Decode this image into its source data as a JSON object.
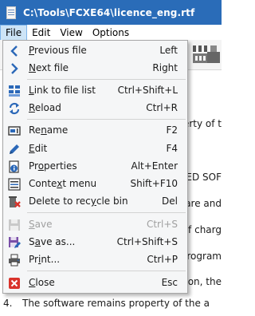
{
  "window": {
    "title": "C:\\Tools\\FCXE64\\licence_eng.rtf",
    "icon": "document-icon"
  },
  "menubar": {
    "items": [
      {
        "label": "File",
        "active": true
      },
      {
        "label": "Edit"
      },
      {
        "label": "View"
      },
      {
        "label": "Options"
      }
    ]
  },
  "file_menu": {
    "items": [
      {
        "label": "Previous file",
        "accel": "P",
        "shortcut": "Left",
        "icon": "chevron-left-icon"
      },
      {
        "label": "Next file",
        "accel": "N",
        "shortcut": "Right",
        "icon": "chevron-right-icon"
      },
      {
        "label": "Link to file list",
        "accel": "L",
        "shortcut": "Ctrl+Shift+L",
        "icon": "link-icon"
      },
      {
        "label": "Reload",
        "accel": "R",
        "shortcut": "Ctrl+R",
        "icon": "reload-icon"
      },
      {
        "label": "Rename",
        "accel": "n",
        "shortcut": "F2",
        "icon": "rename-icon"
      },
      {
        "label": "Edit",
        "accel": "E",
        "shortcut": "F4",
        "icon": "pencil-icon"
      },
      {
        "label": "Properties",
        "accel": "o",
        "shortcut": "Alt+Enter",
        "icon": "info-icon"
      },
      {
        "label": "Context menu",
        "accel": "x",
        "shortcut": "Shift+F10",
        "icon": "context-menu-icon"
      },
      {
        "label": "Delete to recycle bin",
        "accel": "y",
        "shortcut": "Del",
        "icon": "delete-icon"
      },
      {
        "label": "Save",
        "accel": "S",
        "shortcut": "Ctrl+S",
        "icon": "save-icon",
        "disabled": true
      },
      {
        "label": "Save as...",
        "accel": "a",
        "shortcut": "Ctrl+Shift+S",
        "icon": "save-as-icon"
      },
      {
        "label": "Print...",
        "accel": "i",
        "shortcut": "Ctrl+P",
        "icon": "print-icon"
      },
      {
        "label": "Close",
        "accel": "C",
        "shortcut": "Esc",
        "icon": "close-icon"
      }
    ]
  },
  "document": {
    "visible_fragments": [
      "erty of t",
      "ED SOF",
      "are and",
      "of charg",
      "program",
      "on, the"
    ],
    "list_number": "4.",
    "list_text": "The software remains property of the a"
  },
  "colors": {
    "titlebar": "#2a6cb8",
    "menu_active_bg": "#cde4f7",
    "menu_active_border": "#7eb4ea",
    "dropdown_bg": "#f5f6f7",
    "disabled_text": "#a0a0a0",
    "icon_blue": "#2b68b8",
    "icon_red": "#d9332b"
  }
}
